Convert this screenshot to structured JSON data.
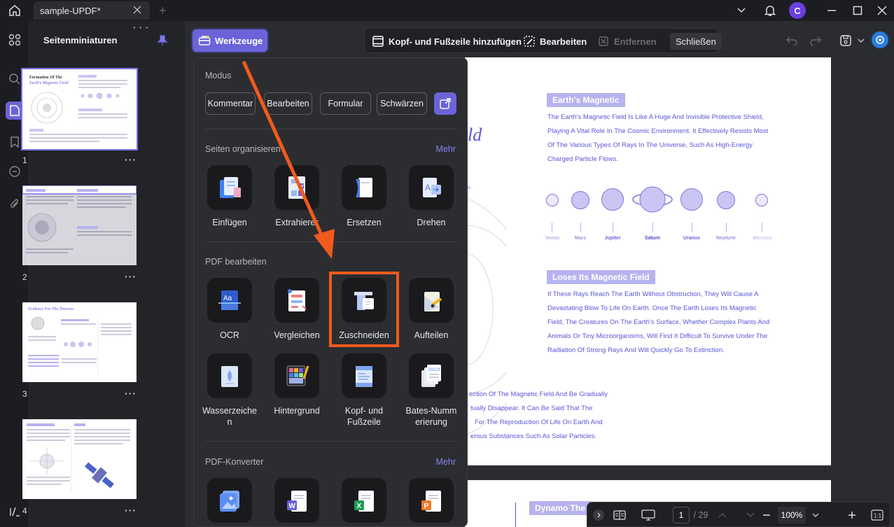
{
  "titlebar": {
    "tab_title": "sample-UPDF*",
    "avatar_letter": "C"
  },
  "thumbnail_panel": {
    "title": "Seitenminiaturen",
    "pages": [
      {
        "number": "1",
        "title_line1": "Formation Of The",
        "title_line2": "Earth's Magnetic Field"
      },
      {
        "number": "2"
      },
      {
        "number": "3",
        "title": "Evidence For The Theories"
      },
      {
        "number": "4"
      }
    ]
  },
  "toolbar": {
    "tools_button": "Werkzeuge",
    "add_header_footer": "Kopf- und Fußzeile hinzufügen",
    "edit": "Bearbeiten",
    "remove": "Entfernen",
    "close": "Schließen"
  },
  "tools_menu": {
    "mode_title": "Modus",
    "modes": [
      "Kommentar",
      "Bearbeiten",
      "Formular",
      "Schwärzen"
    ],
    "organize": {
      "title": "Seiten organisieren",
      "more": "Mehr",
      "items": [
        {
          "label": "Einfügen",
          "icon": "insert-pages-icon"
        },
        {
          "label": "Extrahierer",
          "icon": "extract-pages-icon"
        },
        {
          "label": "Ersetzen",
          "icon": "replace-pages-icon"
        },
        {
          "label": "Drehen",
          "icon": "rotate-pages-icon"
        }
      ]
    },
    "edit_pdf": {
      "title": "PDF bearbeiten",
      "items": [
        {
          "label": "OCR",
          "icon": "ocr-icon"
        },
        {
          "label": "Vergleichen",
          "icon": "compare-icon"
        },
        {
          "label": "Zuschneiden",
          "icon": "crop-icon"
        },
        {
          "label": "Aufteilen",
          "icon": "split-icon"
        },
        {
          "label": "Wasserzeichen",
          "icon": "watermark-icon"
        },
        {
          "label": "Hintergrund",
          "icon": "background-icon"
        },
        {
          "label": "Kopf- und Fußzeile",
          "icon": "header-footer-icon"
        },
        {
          "label": "Bates-Nummerierung",
          "icon": "bates-numbering-icon"
        }
      ],
      "label_watermark_l1": "Wasserzeiche",
      "label_watermark_l2": "n",
      "label_header_l1": "Kopf- und",
      "label_header_l2": "Fußzeile",
      "label_bates_l1": "Bates-Numm",
      "label_bates_l2": "erierung"
    },
    "converter": {
      "title": "PDF-Konverter",
      "more": "Mehr"
    }
  },
  "document": {
    "title_fragment": "ld",
    "section1_heading": "Earth's Magnetic",
    "section1_lines": [
      "The Earth's Magnetic Field Is Like A Huge And Invisible Protective Shield,",
      "Playing A Vital Role In The Cosmic Environment. It Effectively Resists Most",
      "Of The Various Types Of Rays In The Universe, Such As High-Energy",
      "Charged Particle Flows."
    ],
    "planets": [
      "Venus",
      "Mars",
      "Jupiter",
      "Saturn",
      "Uranus",
      "Neptune",
      "Mercury"
    ],
    "section2_heading": "Loses Its Magnetic Field",
    "section2_lines": [
      "If These Rays Reach The Earth Without Obstruction, They Will Cause A",
      "Devastating Blow To Life On Earth. Once The Earth Loses Its Magnetic",
      "Field, The Creatures On The Earth's Surface, Whether Complex Plants And",
      "Animals Or Tiny Microorganisms, Will Find It Difficult To Survive Under The",
      "Radiation Of Strong Rays And Will Quickly Go To Extinction."
    ],
    "section3_lines": [
      "ection Of The Magnetic Field And Be Gradually",
      "tually Disappear. It Can Be Said That The",
      "For The Reproduction Of Life On Earth And",
      "erous Substances Such As Solar Particles."
    ],
    "page2_heading": "Dynamo The"
  },
  "bottombar": {
    "current_page": "1",
    "total_pages": "/ 29",
    "zoom": "100%"
  },
  "colors": {
    "accent": "#6c63d9",
    "highlight": "#f15a1d",
    "doc_text": "#5b55d6"
  }
}
